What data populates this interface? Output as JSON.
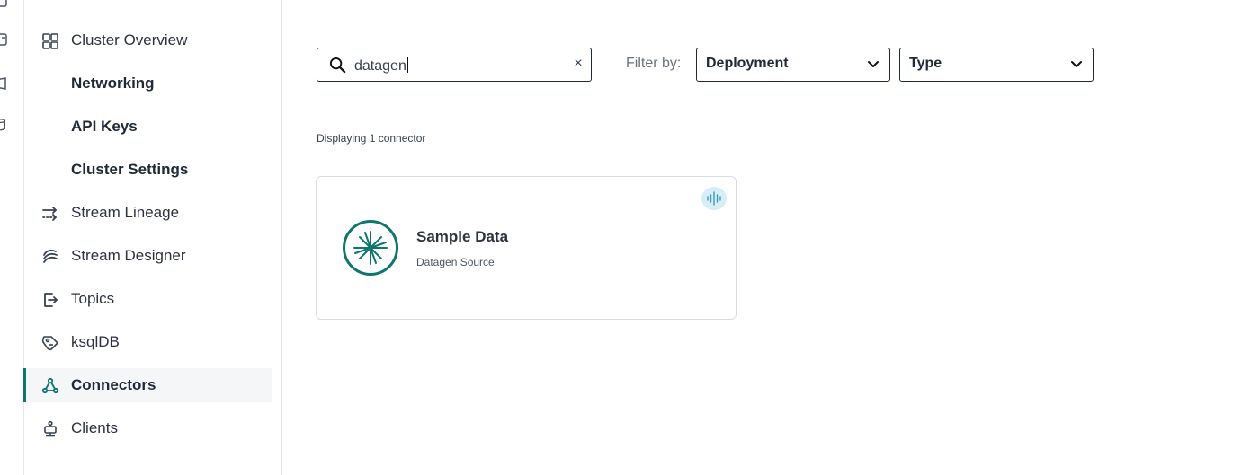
{
  "sidebar": {
    "items": [
      {
        "label": "Cluster Overview",
        "icon": "grid-icon"
      },
      {
        "label": "Networking"
      },
      {
        "label": "API Keys"
      },
      {
        "label": "Cluster Settings"
      },
      {
        "label": "Stream Lineage",
        "icon": "stream-lineage-icon"
      },
      {
        "label": "Stream Designer",
        "icon": "stream-designer-icon"
      },
      {
        "label": "Topics",
        "icon": "topics-icon"
      },
      {
        "label": "ksqlDB",
        "icon": "ksqldb-icon"
      },
      {
        "label": "Connectors",
        "icon": "connectors-icon",
        "active": true
      },
      {
        "label": "Clients",
        "icon": "clients-icon"
      }
    ]
  },
  "search": {
    "value": "datagen",
    "clear_label": "×"
  },
  "filter": {
    "label": "Filter by:",
    "deployment": "Deployment",
    "type": "Type"
  },
  "results": {
    "count_text": "Displaying 1 connector"
  },
  "connector_card": {
    "title": "Sample Data",
    "subtitle": "Datagen Source",
    "badge_icon": "audio-wave-icon",
    "logo_icon": "datagen-logo-icon"
  },
  "colors": {
    "accent": "#0f766e",
    "badge_bg": "#d7eef6",
    "border": "#1f2937"
  }
}
